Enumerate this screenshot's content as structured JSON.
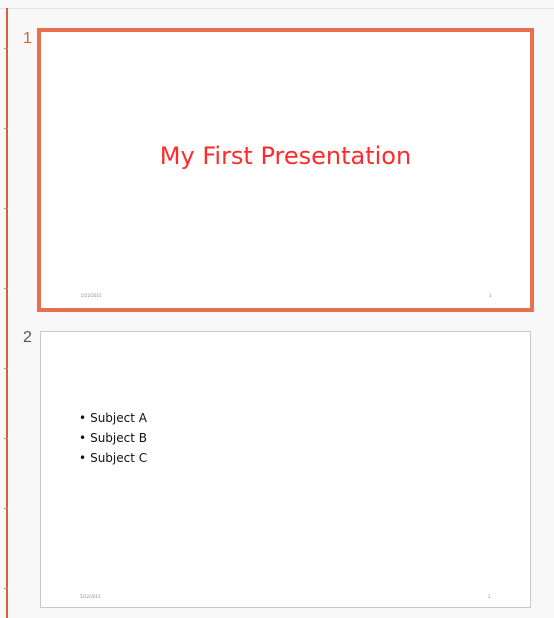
{
  "slides": [
    {
      "number": "1",
      "title": "My First Presentation",
      "footer_date": "5/22/2015",
      "footer_number": "1",
      "selected": true
    },
    {
      "number": "2",
      "bullets": [
        "Subject A",
        "Subject B",
        "Subject C"
      ],
      "bullet_glyph": "•",
      "footer_date": "5/22/2015",
      "footer_number": "2",
      "selected": false
    }
  ],
  "colors": {
    "selection_accent": "#e8704d",
    "title_red": "#ff2a2a"
  }
}
